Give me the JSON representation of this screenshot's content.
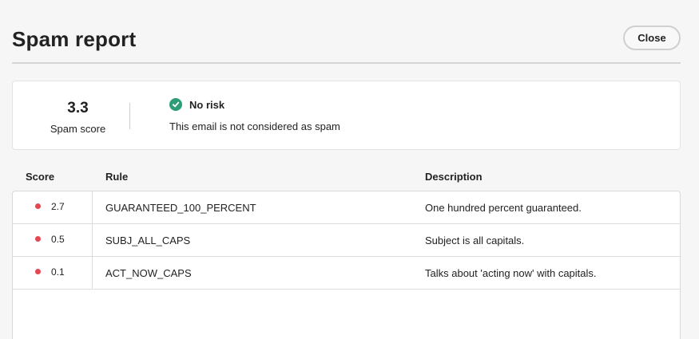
{
  "dialog": {
    "title": "Spam report",
    "close_label": "Close"
  },
  "summary": {
    "score": "3.3",
    "score_label": "Spam score",
    "risk_title": "No risk",
    "risk_icon": "check-circle-icon",
    "risk_color": "#2d9d78",
    "risk_description": "This email is not considered as spam"
  },
  "table": {
    "headers": {
      "score": "Score",
      "rule": "Rule",
      "description": "Description"
    },
    "severity_color": "#e34850",
    "rows": [
      {
        "score": "2.7",
        "rule": "GUARANTEED_100_PERCENT",
        "description": "One hundred percent guaranteed."
      },
      {
        "score": "0.5",
        "rule": "SUBJ_ALL_CAPS",
        "description": "Subject is all capitals."
      },
      {
        "score": "0.1",
        "rule": "ACT_NOW_CAPS",
        "description": "Talks about 'acting now' with capitals."
      }
    ]
  }
}
